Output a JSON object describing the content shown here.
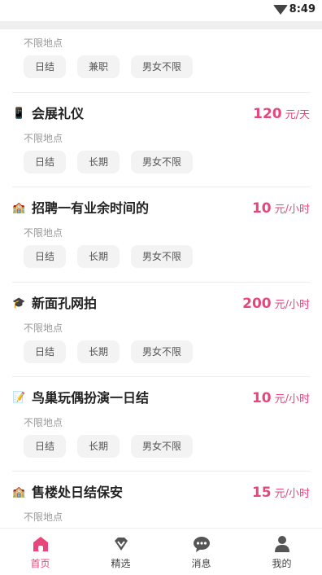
{
  "status_bar": {
    "time": "8:49"
  },
  "jobs": [
    {
      "icon": "",
      "title": "",
      "pay_amount": "",
      "pay_unit": "",
      "location": "不限地点",
      "tags": [
        "日结",
        "兼职",
        "男女不限"
      ]
    },
    {
      "icon": "phone-icon",
      "icon_glyph": "📱",
      "title": "会展礼仪",
      "pay_amount": "120",
      "pay_unit": "元/天",
      "location": "不限地点",
      "tags": [
        "日结",
        "长期",
        "男女不限"
      ]
    },
    {
      "icon": "building-icon",
      "icon_glyph": "🏫",
      "title": "招聘一有业余时间的",
      "pay_amount": "10",
      "pay_unit": "元/小时",
      "location": "不限地点",
      "tags": [
        "日结",
        "长期",
        "男女不限"
      ]
    },
    {
      "icon": "graduation-cap-icon",
      "icon_glyph": "🎓",
      "title": "新面孔网拍",
      "pay_amount": "200",
      "pay_unit": "元/小时",
      "location": "不限地点",
      "tags": [
        "日结",
        "长期",
        "男女不限"
      ]
    },
    {
      "icon": "memo-icon",
      "icon_glyph": "📝",
      "title": "鸟巢玩偶扮演一日结",
      "pay_amount": "10",
      "pay_unit": "元/小时",
      "location": "不限地点",
      "tags": [
        "日结",
        "长期",
        "男女不限"
      ]
    },
    {
      "icon": "building-icon",
      "icon_glyph": "🏫",
      "title": "售楼处日结保安",
      "pay_amount": "15",
      "pay_unit": "元/小时",
      "location": "不限地点",
      "tags": []
    }
  ],
  "tabbar": {
    "items": [
      {
        "label": "首页",
        "icon": "home-icon",
        "active": true
      },
      {
        "label": "精选",
        "icon": "diamond-icon",
        "active": false
      },
      {
        "label": "消息",
        "icon": "message-icon",
        "active": false
      },
      {
        "label": "我的",
        "icon": "person-icon",
        "active": false
      }
    ]
  },
  "colors": {
    "accent": "#e8457a",
    "tag_bg": "#f3f3f3",
    "muted_text": "#999999"
  }
}
